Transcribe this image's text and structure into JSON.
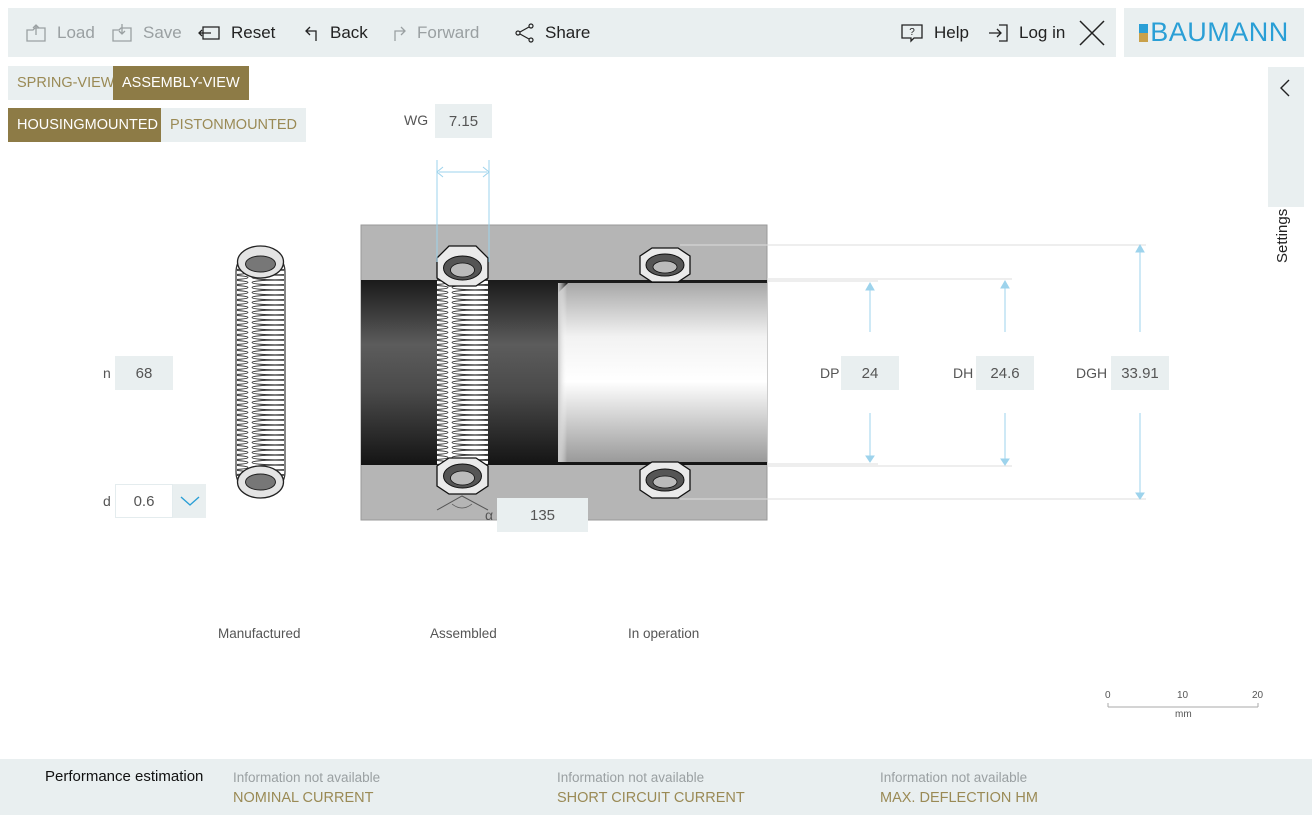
{
  "toolbar": {
    "load": "Load",
    "save": "Save",
    "reset": "Reset",
    "back": "Back",
    "forward": "Forward",
    "share": "Share",
    "help": "Help",
    "login": "Log in"
  },
  "brand": {
    "name": "BAUMANN",
    "color": "#2a9fd6",
    "mark_colors": [
      "#2a9fd6",
      "#c9a14a"
    ]
  },
  "view_toggle": {
    "spring_view": "SPRING-VIEW",
    "assembly_view": "ASSEMBLY-VIEW",
    "selected": "ASSEMBLY-VIEW"
  },
  "mount_toggle": {
    "housing": "HOUSINGMOUNTED",
    "piston": "PISTONMOUNTED",
    "selected": "HOUSINGMOUNTED"
  },
  "settings": {
    "label": "Settings"
  },
  "params": {
    "wg": {
      "label": "WG",
      "value": "7.15"
    },
    "n": {
      "label": "n",
      "value": "68"
    },
    "d": {
      "label": "d",
      "value": "0.6"
    },
    "alpha": {
      "label": "α",
      "value": "135"
    },
    "dp": {
      "label": "DP",
      "value": "24"
    },
    "dh": {
      "label": "DH",
      "value": "24.6"
    },
    "dgh": {
      "label": "DGH",
      "value": "33.91"
    }
  },
  "captions": {
    "manufactured": "Manufactured",
    "assembled": "Assembled",
    "operation": "In operation"
  },
  "scale": {
    "ticks": [
      "0",
      "10",
      "20"
    ],
    "unit": "mm"
  },
  "footer": {
    "title": "Performance estimation",
    "items": [
      {
        "status": "Information not available",
        "name": "NOMINAL CURRENT"
      },
      {
        "status": "Information not available",
        "name": "SHORT CIRCUIT CURRENT"
      },
      {
        "status": "Information not available",
        "name": "MAX. DEFLECTION HM"
      }
    ]
  },
  "colors": {
    "panel": "#e9eff0",
    "accent": "#8d7b46",
    "accent_text": "#9a8a55",
    "dim": "#9dd3ec"
  }
}
